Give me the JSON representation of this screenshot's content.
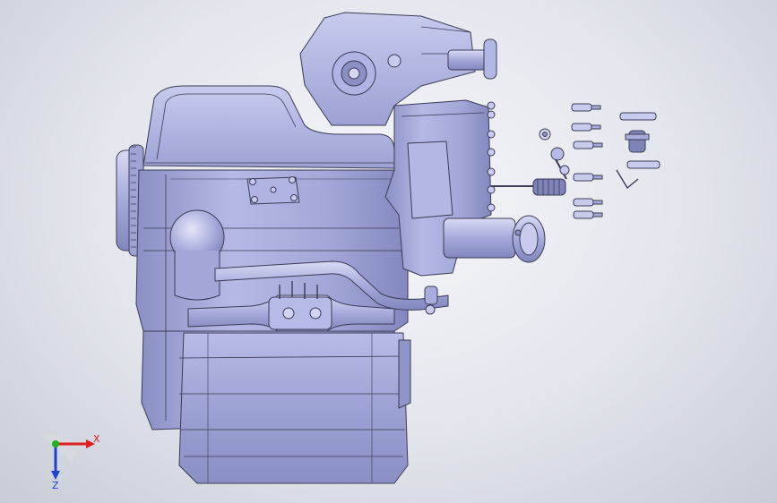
{
  "viewport": {
    "colors": {
      "model_fill": "#a9aedb",
      "model_shade": "#8f95c9",
      "model_light": "#c4c8ec",
      "edge": "#3a3c55",
      "x_axis": "#e02020",
      "y_axis": "#20b020",
      "z_axis": "#2040d0"
    }
  },
  "triad": {
    "x_label": "X",
    "z_label": "Z"
  }
}
